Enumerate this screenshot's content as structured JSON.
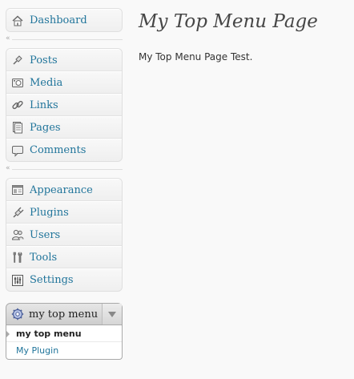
{
  "sidebar": {
    "dashboard": {
      "label": "Dashboard",
      "icon": "dashboard-house-icon"
    },
    "content_items": [
      {
        "label": "Posts",
        "icon": "posts-pin-icon"
      },
      {
        "label": "Media",
        "icon": "media-camera-icon"
      },
      {
        "label": "Links",
        "icon": "links-chain-icon"
      },
      {
        "label": "Pages",
        "icon": "pages-icon"
      },
      {
        "label": "Comments",
        "icon": "comments-bubble-icon"
      }
    ],
    "admin_items": [
      {
        "label": "Appearance",
        "icon": "appearance-icon"
      },
      {
        "label": "Plugins",
        "icon": "plugins-icon"
      },
      {
        "label": "Users",
        "icon": "users-icon"
      },
      {
        "label": "Tools",
        "icon": "tools-icon"
      },
      {
        "label": "Settings",
        "icon": "settings-icon"
      }
    ],
    "active_menu": {
      "label": "my top menu",
      "icon": "gear-icon",
      "submenu": [
        {
          "label": "my top menu",
          "current": true
        },
        {
          "label": "My Plugin",
          "current": false
        }
      ]
    }
  },
  "main": {
    "title": "My Top Menu Page",
    "body": "My Top Menu Page Test."
  },
  "colors": {
    "link": "#21759b",
    "background": "#f9f9f9"
  }
}
